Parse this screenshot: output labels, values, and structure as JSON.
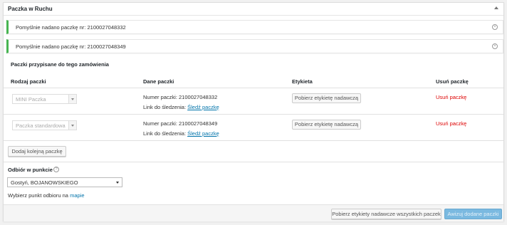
{
  "panel": {
    "title": "Paczka w Ruchu"
  },
  "notices": [
    {
      "text": "Pomyślnie nadano paczkę nr: 2100027048332"
    },
    {
      "text": "Pomyślnie nadano paczkę nr: 2100027048349"
    }
  ],
  "packages_section": {
    "title": "Paczki przypisane do tego zamówienia"
  },
  "table": {
    "headers": {
      "type": "Rodzaj paczki",
      "details": "Dane paczki",
      "label": "Etykieta",
      "delete": "Usuń paczkę"
    },
    "rows": [
      {
        "type": "MINI Paczka",
        "number": "Numer paczki: 2100027048332",
        "tracking_label": "Link do śledzenia:",
        "tracking_link": "Śledź paczkę",
        "label_button": "Pobierz etykietę nadawczą",
        "delete_link": "Usuń paczkę"
      },
      {
        "type": "Paczka standardowa",
        "number": "Numer paczki: 2100027048349",
        "tracking_label": "Link do śledzenia:",
        "tracking_link": "Śledź paczkę",
        "label_button": "Pobierz etykietę nadawczą",
        "delete_link": "Usuń paczkę"
      }
    ]
  },
  "add_package_button": "Dodaj kolejną paczkę",
  "pickup": {
    "label": "Odbiór w punkcie",
    "selected": "Gostyń, BOJANOWSKIEGO",
    "hint_prefix": "Wybierz punkt odbioru na",
    "hint_link": "mapie"
  },
  "footer": {
    "download_all_button": "Pobierz etykiety nadawcze wszystkich paczek",
    "send_button": "Awizuj dodane paczki"
  },
  "colors": {
    "success": "#46b450",
    "link": "#0073aa",
    "danger": "#dd0000",
    "primary": "#7ab9e0"
  },
  "icons": {
    "toggle": "arrow-up-icon",
    "dismiss": "dismiss-icon",
    "help": "help-icon",
    "select_arrow": "chevron-down-icon"
  }
}
